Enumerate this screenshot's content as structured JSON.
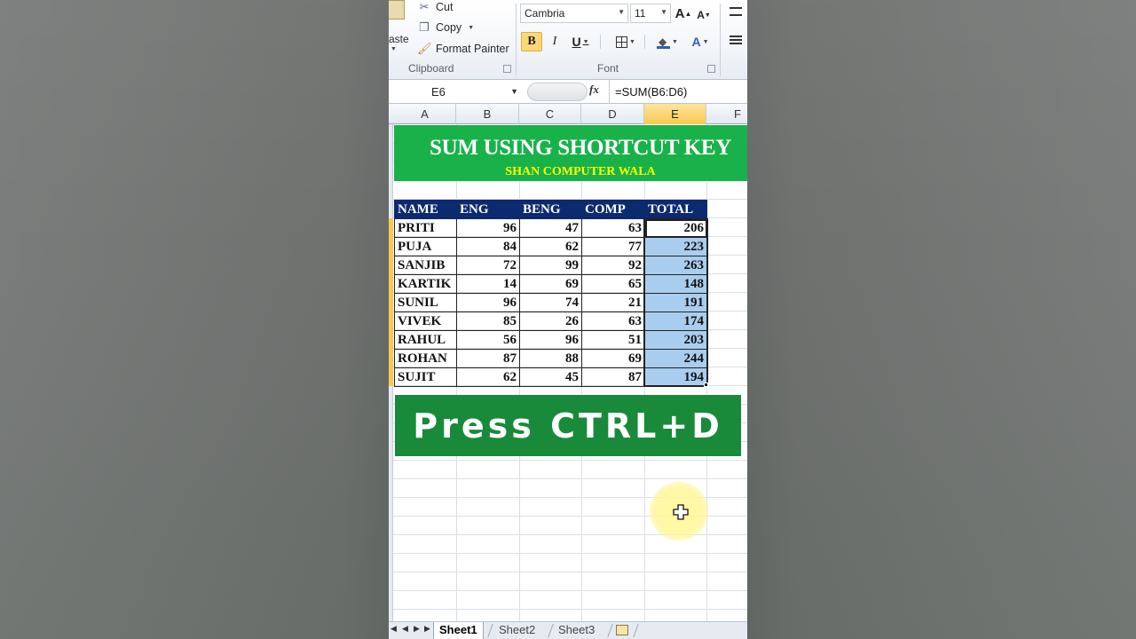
{
  "ribbon": {
    "clipboard": {
      "paste_label": "aste",
      "cut_label": "Cut",
      "copy_label": "Copy",
      "format_painter_label": "Format Painter",
      "group_label": "Clipboard"
    },
    "font": {
      "font_name": "Cambria",
      "font_size": "11",
      "group_label": "Font",
      "bold": "B",
      "italic": "I",
      "underline": "U",
      "grow_font": "A",
      "shrink_font": "A",
      "font_color": "A"
    }
  },
  "formula_bar": {
    "name_box": "E6",
    "fx_label": "fx",
    "formula": "=SUM(B6:D6)"
  },
  "columns": [
    "A",
    "B",
    "C",
    "D",
    "E",
    "F"
  ],
  "active_column": "E",
  "banner": {
    "title": "SUM USING SHORTCUT KEY",
    "subtitle": "SHAN COMPUTER WALA"
  },
  "table": {
    "headers": [
      "NAME",
      "ENG",
      "BENG",
      "COMP",
      "TOTAL"
    ],
    "rows": [
      [
        "PRITI",
        "96",
        "47",
        "63",
        "206"
      ],
      [
        "PUJA",
        "84",
        "62",
        "77",
        "223"
      ],
      [
        "SANJIB",
        "72",
        "99",
        "92",
        "263"
      ],
      [
        "KARTIK",
        "14",
        "69",
        "65",
        "148"
      ],
      [
        "SUNIL",
        "96",
        "74",
        "21",
        "191"
      ],
      [
        "VIVEK",
        "85",
        "26",
        "63",
        "174"
      ],
      [
        "RAHUL",
        "56",
        "96",
        "51",
        "203"
      ],
      [
        "ROHAN",
        "87",
        "88",
        "69",
        "244"
      ],
      [
        "SUJIT",
        "62",
        "45",
        "87",
        "194"
      ]
    ]
  },
  "callout": "Press CTRL+D",
  "sheet_tabs": [
    "Sheet1",
    "Sheet2",
    "Sheet3"
  ],
  "active_sheet": "Sheet1",
  "colors": {
    "banner_green": "#19b24a",
    "callout_green": "#188a3a",
    "header_navy": "#0b2a6f",
    "selection_blue": "#a9cdee",
    "subtitle_yellow": "#ffff00"
  }
}
